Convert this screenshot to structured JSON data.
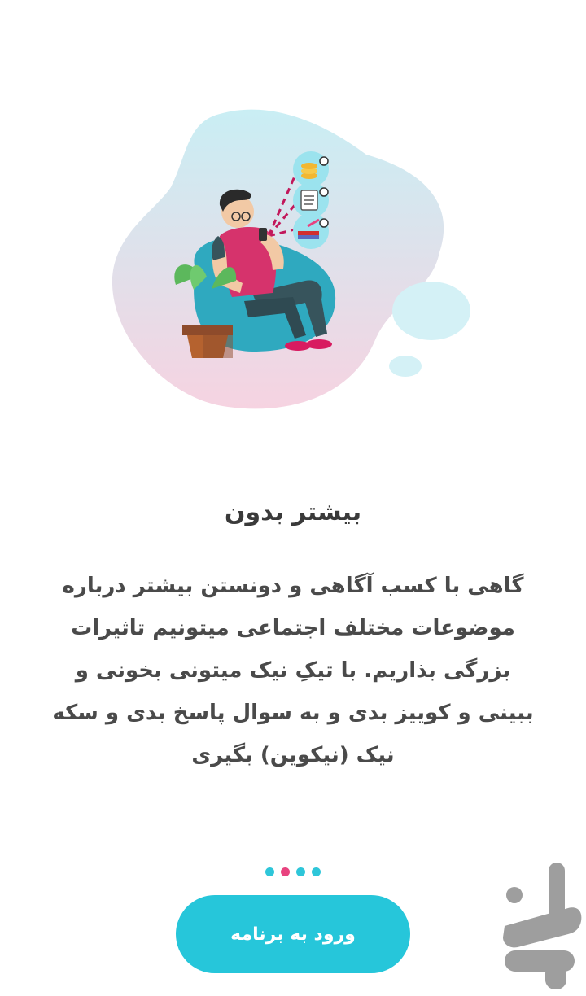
{
  "illustration": {
    "icon": "person-on-beanbag-with-phone-illustration",
    "colors": {
      "blob_top": "#c9eef4",
      "blob_bottom": "#f6d3e1",
      "accent_pink": "#e8437f",
      "accent_teal": "#2ec6d9"
    }
  },
  "onboarding": {
    "title": "بیشتر بدون",
    "description": "گاهی با کسب آگاهی و دونستن بیشتر درباره موضوعات مختلف اجتماعی میتونیم تاثیرات بزرگی بذاریم. با تیکِ نیک میتونی بخونی و ببینی و کوییز بدی و به سوال پاسخ بدی و سکه نیک (نیکوین) بگیری",
    "pages_total": 4,
    "active_page": 2
  },
  "actions": {
    "enter_label": "ورود به برنامه"
  },
  "watermark": {
    "icon": "bazaar-logo-icon",
    "color": "#9e9e9e"
  },
  "colors": {
    "primary": "#26c6da",
    "active_dot": "#e8437f",
    "text": "#3a3a3a"
  }
}
